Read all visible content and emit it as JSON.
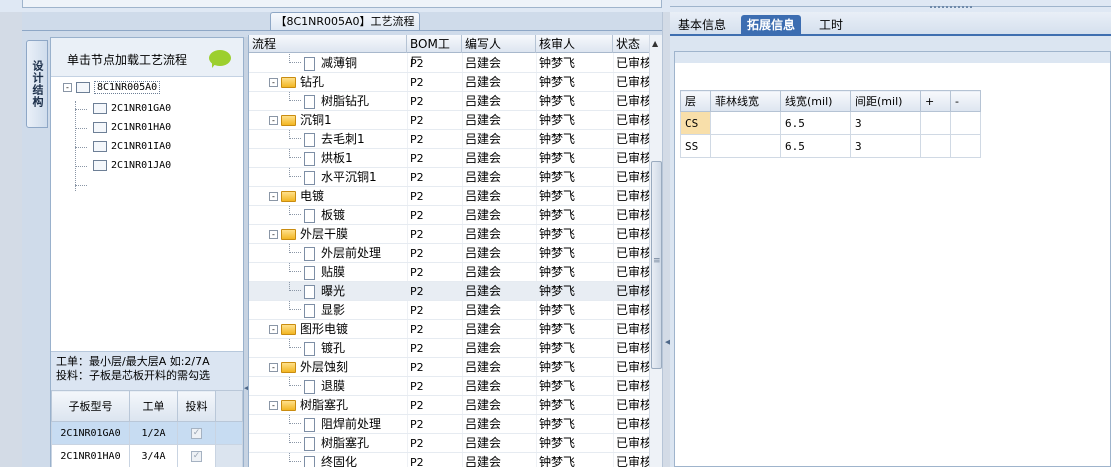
{
  "process_tab": "【8C1NR005A0】工艺流程",
  "vertical_tab": "设计结构",
  "left": {
    "header_text": "单击节点加载工艺流程",
    "tree": [
      {
        "label": "8C1NR005A0",
        "level": 0,
        "expander": "-",
        "selected": true
      },
      {
        "label": "2C1NR01GA0",
        "level": 1
      },
      {
        "label": "2C1NR01HA0",
        "level": 1
      },
      {
        "label": "2C1NR01IA0",
        "level": 1
      },
      {
        "label": "2C1NR01JA0",
        "level": 1
      }
    ],
    "note_line1": "工单：最小层/最大层A 如:2/7A",
    "note_line2": "投料：子板是芯板开料的需勾选",
    "grid_headers": [
      "子板型号",
      "工单",
      "投料"
    ],
    "grid_rows": [
      {
        "model": "2C1NR01GA0",
        "order": "1/2A",
        "feed": "✓",
        "selected": true
      },
      {
        "model": "2C1NR01HA0",
        "order": "3/4A",
        "feed": "✓"
      }
    ]
  },
  "mid": {
    "headers": {
      "flow": "流程",
      "bom": "BOM工厂",
      "author": "编写人",
      "reviewer": "核审人",
      "status": "状态"
    },
    "rows": [
      {
        "type": "doc",
        "name": "减薄铜",
        "bom": "P2",
        "author": "吕建会",
        "reviewer": "钟梦飞",
        "status": "已审核"
      },
      {
        "type": "folder",
        "name": "钻孔",
        "bom": "P2",
        "author": "吕建会",
        "reviewer": "钟梦飞",
        "status": "已审核"
      },
      {
        "type": "doc",
        "name": "树脂钻孔",
        "bom": "P2",
        "author": "吕建会",
        "reviewer": "钟梦飞",
        "status": "已审核"
      },
      {
        "type": "folder",
        "name": "沉铜1",
        "bom": "P2",
        "author": "吕建会",
        "reviewer": "钟梦飞",
        "status": "已审核"
      },
      {
        "type": "doc",
        "name": "去毛刺1",
        "bom": "P2",
        "author": "吕建会",
        "reviewer": "钟梦飞",
        "status": "已审核"
      },
      {
        "type": "doc",
        "name": "烘板1",
        "bom": "P2",
        "author": "吕建会",
        "reviewer": "钟梦飞",
        "status": "已审核"
      },
      {
        "type": "doc",
        "name": "水平沉铜1",
        "bom": "P2",
        "author": "吕建会",
        "reviewer": "钟梦飞",
        "status": "已审核"
      },
      {
        "type": "folder",
        "name": "电镀",
        "bom": "P2",
        "author": "吕建会",
        "reviewer": "钟梦飞",
        "status": "已审核"
      },
      {
        "type": "doc",
        "name": "板镀",
        "bom": "P2",
        "author": "吕建会",
        "reviewer": "钟梦飞",
        "status": "已审核"
      },
      {
        "type": "folder",
        "name": "外层干膜",
        "bom": "P2",
        "author": "吕建会",
        "reviewer": "钟梦飞",
        "status": "已审核"
      },
      {
        "type": "doc",
        "name": "外层前处理",
        "bom": "P2",
        "author": "吕建会",
        "reviewer": "钟梦飞",
        "status": "已审核"
      },
      {
        "type": "doc",
        "name": "贴膜",
        "bom": "P2",
        "author": "吕建会",
        "reviewer": "钟梦飞",
        "status": "已审核"
      },
      {
        "type": "doc",
        "name": "曝光",
        "bom": "P2",
        "author": "吕建会",
        "reviewer": "钟梦飞",
        "status": "已审核",
        "selected": true
      },
      {
        "type": "doc",
        "name": "显影",
        "bom": "P2",
        "author": "吕建会",
        "reviewer": "钟梦飞",
        "status": "已审核"
      },
      {
        "type": "folder",
        "name": "图形电镀",
        "bom": "P2",
        "author": "吕建会",
        "reviewer": "钟梦飞",
        "status": "已审核"
      },
      {
        "type": "doc",
        "name": "镀孔",
        "bom": "P2",
        "author": "吕建会",
        "reviewer": "钟梦飞",
        "status": "已审核"
      },
      {
        "type": "folder",
        "name": "外层蚀刻",
        "bom": "P2",
        "author": "吕建会",
        "reviewer": "钟梦飞",
        "status": "已审核"
      },
      {
        "type": "doc",
        "name": "退膜",
        "bom": "P2",
        "author": "吕建会",
        "reviewer": "钟梦飞",
        "status": "已审核"
      },
      {
        "type": "folder",
        "name": "树脂塞孔",
        "bom": "P2",
        "author": "吕建会",
        "reviewer": "钟梦飞",
        "status": "已审核"
      },
      {
        "type": "doc",
        "name": "阻焊前处理",
        "bom": "P2",
        "author": "吕建会",
        "reviewer": "钟梦飞",
        "status": "已审核"
      },
      {
        "type": "doc",
        "name": "树脂塞孔",
        "bom": "P2",
        "author": "吕建会",
        "reviewer": "钟梦飞",
        "status": "已审核"
      },
      {
        "type": "doc",
        "name": "终固化",
        "bom": "P2",
        "author": "吕建会",
        "reviewer": "钟梦飞",
        "status": "已审核"
      }
    ]
  },
  "right": {
    "tabs": [
      {
        "label": "基本信息",
        "active": false
      },
      {
        "label": "拓展信息",
        "active": true
      },
      {
        "label": "工时",
        "active": false
      }
    ],
    "table_headers": [
      "层",
      "菲林线宽",
      "线宽(mil)",
      "间距(mil)",
      "+",
      "-"
    ],
    "table_rows": [
      {
        "layer": "CS",
        "film": "",
        "width": "6.5",
        "spacing": "3",
        "plus": "",
        "minus": ""
      },
      {
        "layer": "SS",
        "film": "",
        "width": "6.5",
        "spacing": "3",
        "plus": "",
        "minus": ""
      }
    ]
  }
}
